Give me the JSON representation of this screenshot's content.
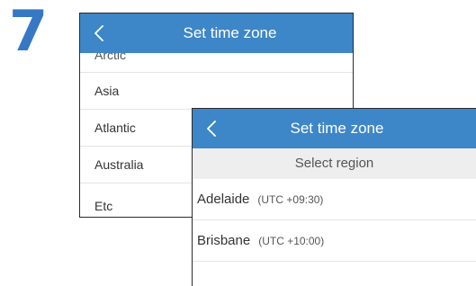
{
  "step": {
    "number": "7"
  },
  "screen_back": {
    "title": "Set time zone",
    "regions": [
      {
        "label": "Arctic"
      },
      {
        "label": "Asia"
      },
      {
        "label": "Atlantic"
      },
      {
        "label": "Australia"
      },
      {
        "label": "Etc"
      }
    ]
  },
  "screen_front": {
    "title": "Set time zone",
    "subheader": "Select region",
    "cities": [
      {
        "name": "Adelaide",
        "offset": "(UTC +09:30)"
      },
      {
        "name": "Brisbane",
        "offset": "(UTC +10:00)"
      }
    ]
  },
  "icons": {
    "back": "chevron-left-icon"
  },
  "colors": {
    "accent": "#3d86c8",
    "step_number": "#3678c4",
    "subheader_bg": "#eeeeee",
    "divider": "#e4e4e4"
  }
}
